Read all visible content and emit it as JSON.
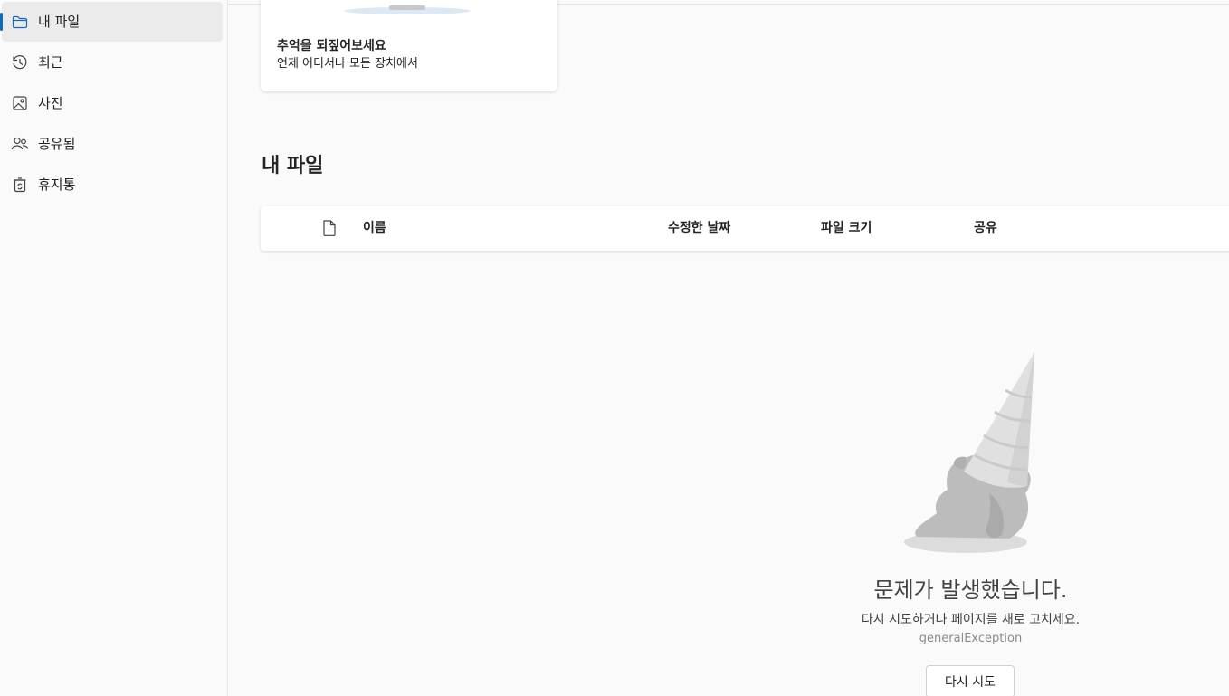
{
  "sidebar": {
    "items": [
      {
        "label": "내 파일",
        "icon": "folder-icon",
        "active": true
      },
      {
        "label": "최근",
        "icon": "history-icon"
      },
      {
        "label": "사진",
        "icon": "image-icon"
      },
      {
        "label": "공유됨",
        "icon": "people-icon"
      },
      {
        "label": "휴지통",
        "icon": "recycle-bin-icon"
      }
    ]
  },
  "card": {
    "title": "추억을 되짚어보세요",
    "subtitle": "언제 어디서나 모든 장치에서"
  },
  "main": {
    "section_title": "내 파일",
    "columns": {
      "name": "이름",
      "modified": "수정한 날짜",
      "size": "파일 크기",
      "sharing": "공유"
    }
  },
  "error": {
    "title": "문제가 발생했습니다.",
    "description": "다시 시도하거나 페이지를 새로 고치세요.",
    "code": "generalException",
    "retry_label": "다시 시도"
  },
  "colors": {
    "accent": "#0f6cbd",
    "active_bg": "#ebebeb",
    "background": "#fafafa"
  }
}
